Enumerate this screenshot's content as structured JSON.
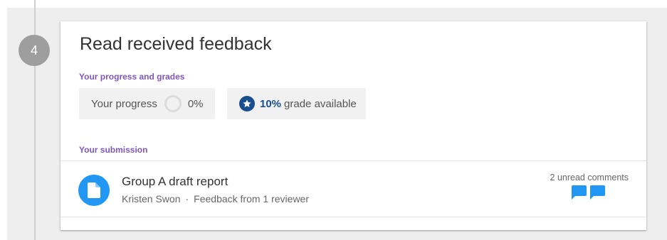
{
  "step": {
    "number": "4"
  },
  "card": {
    "title": "Read received feedback",
    "progress_section_label": "Your progress and grades",
    "progress": {
      "label": "Your progress",
      "value": "0%",
      "fraction": 0
    },
    "grade": {
      "percent": "10%",
      "text": "grade available"
    },
    "submission_section_label": "Your submission",
    "submission": {
      "title": "Group A draft report",
      "author": "Kristen Swon",
      "separator": "·",
      "feedback": "Feedback from 1 reviewer",
      "unread_comments": "2 unread comments"
    }
  },
  "colors": {
    "accent_purple": "#7e57c2",
    "grade_blue": "#1a4e8f",
    "doc_blue": "#2196f3",
    "comment_blue": "#2196f3",
    "badge_grey": "#9e9e9e"
  },
  "icons": {
    "grade": "star-icon",
    "document": "document-icon",
    "comments": "chat-bubble-icon"
  }
}
